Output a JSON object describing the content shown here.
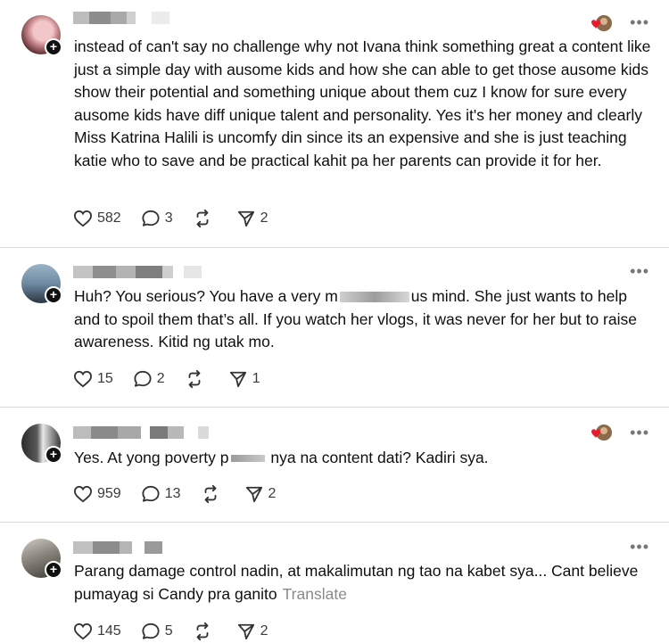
{
  "posts": [
    {
      "text": "instead of can't say no challenge why not Ivana think something great a content like just a simple day with ausome kids and how she can able to get those ausome kids show their potential and something unique about them cuz I know for sure every ausome kids have diff unique talent and personality. Yes it's her money and clearly Miss Katrina Halili is uncomfy din since its an expensive and she is just teaching katie who to save and be practical kahit pa her parents can provide it for her.",
      "likes": "582",
      "replies": "3",
      "shares": "2"
    },
    {
      "text_before": "Huh? You serious? You have a very m",
      "text_after": "us mind. She just wants to help and to spoil them that’s all. If you watch her vlogs, it was never for her but to raise awareness. Kitid ng utak mo.",
      "likes": "15",
      "replies": "2",
      "shares": "1"
    },
    {
      "text_before": "Yes. At yong poverty p",
      "text_after": " nya na content dati? Kadiri sya.",
      "likes": "959",
      "replies": "13",
      "shares": "2"
    },
    {
      "text": "Parang damage control nadin, at makalimutan ng tao na kabet sya... Cant believe pumayag si Candy pra ganito",
      "translate": "Translate",
      "likes": "145",
      "replies": "5",
      "shares": "2"
    }
  ],
  "more_glyph": "•••",
  "colors": {
    "heart_red": "#e8192c",
    "divider": "#d9d9d9",
    "muted": "#8a8a8a"
  }
}
